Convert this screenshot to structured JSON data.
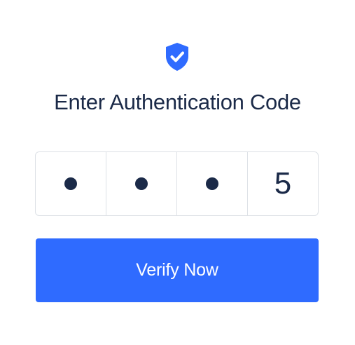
{
  "icon": "shield-check-icon",
  "title": "Enter Authentication Code",
  "code": {
    "masked_placeholder": "•",
    "cells": [
      {
        "masked": true,
        "value": ""
      },
      {
        "masked": true,
        "value": ""
      },
      {
        "masked": true,
        "value": ""
      },
      {
        "masked": false,
        "value": "5"
      }
    ]
  },
  "verify_button": {
    "label": "Verify Now"
  },
  "colors": {
    "accent": "#2f6bff",
    "text": "#1b2a48",
    "border": "#dde1e6"
  }
}
